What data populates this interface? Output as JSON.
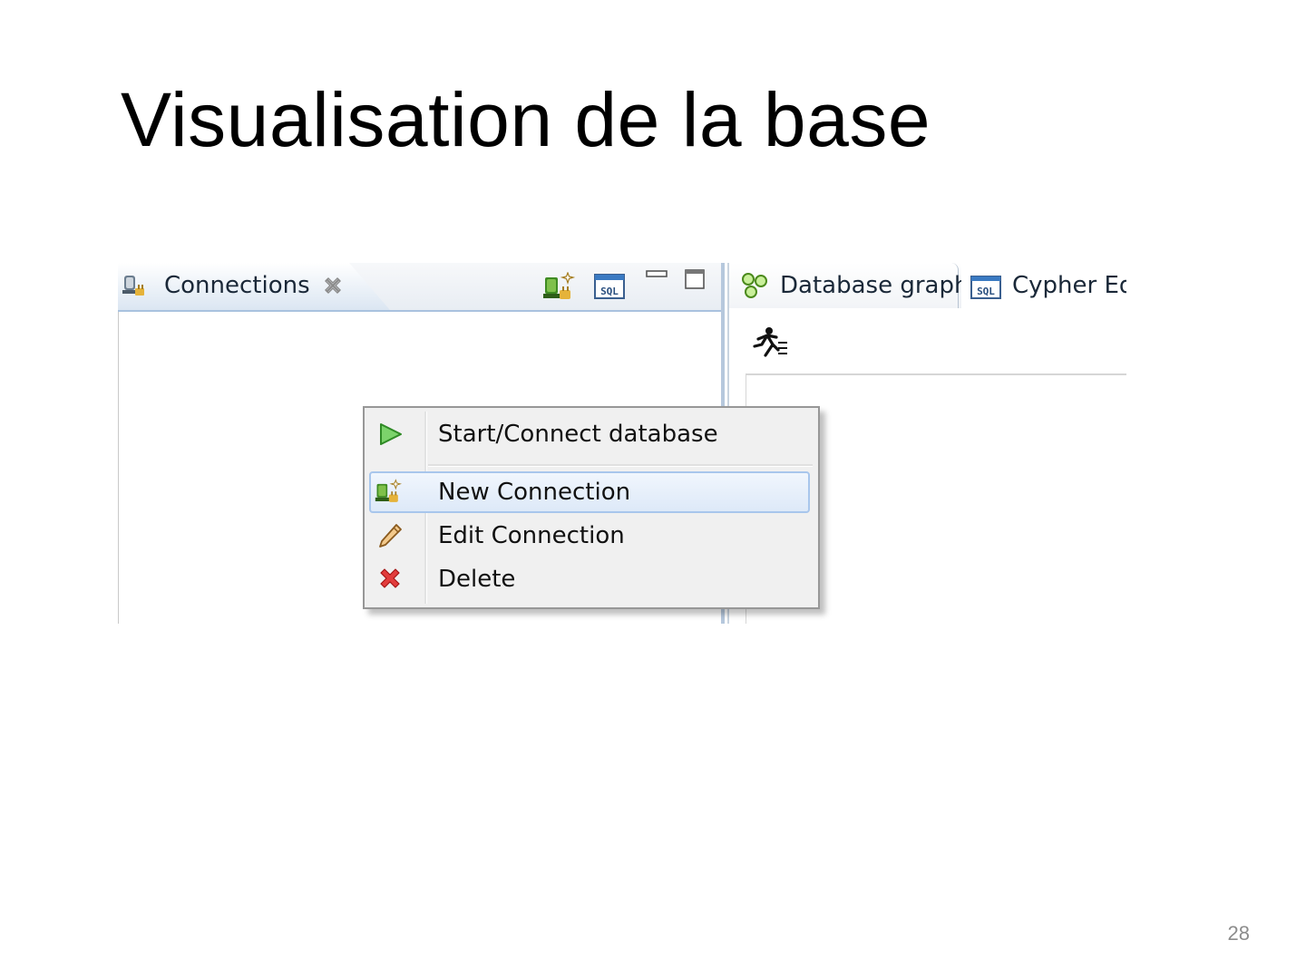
{
  "slide": {
    "title": "Visualisation de la base",
    "page_number": "28"
  },
  "connections_view": {
    "tab_label": "Connections",
    "icons": [
      "connections-icon",
      "close-icon",
      "new-connection-icon",
      "sql-editor-icon",
      "minimize-icon",
      "maximize-icon"
    ]
  },
  "right_view": {
    "tabs": [
      {
        "label": "Database graph",
        "icon": "database-graph-icon"
      },
      {
        "label": "Cypher Ed",
        "icon": "sql-icon"
      }
    ],
    "toolbar_icons": [
      "run-query-icon"
    ]
  },
  "context_menu": {
    "items": [
      {
        "label": "Start/Connect database",
        "icon": "play-icon",
        "selected": false
      },
      {
        "label": "New Connection",
        "icon": "new-connection-icon",
        "selected": true
      },
      {
        "label": "Edit Connection",
        "icon": "pencil-icon",
        "selected": false
      },
      {
        "label": "Delete",
        "icon": "delete-x-icon",
        "selected": false
      }
    ]
  },
  "colors": {
    "menu_background": "#f0f0f0",
    "selection_border": "#a8c6ec",
    "view_border": "#b6c8dd",
    "page_number": "#8c8c8c"
  }
}
